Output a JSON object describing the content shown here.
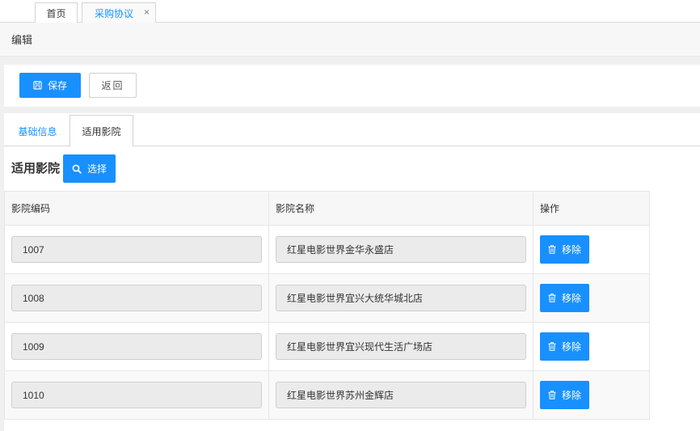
{
  "top_tabs": {
    "home": "首页",
    "active": "采购协议",
    "close": "×"
  },
  "title": "编辑",
  "toolbar": {
    "save_label": "保存",
    "back_label": "返回"
  },
  "content_tabs": {
    "basic": "基础信息",
    "cinemas": "适用影院"
  },
  "section": {
    "title": "适用影院",
    "select_label": "选择"
  },
  "table": {
    "headers": [
      "影院编码",
      "影院名称",
      "操作"
    ],
    "remove_label": "移除",
    "rows": [
      {
        "code": "1007",
        "name": "红星电影世界金华永盛店"
      },
      {
        "code": "1008",
        "name": "红星电影世界宜兴大统华城北店"
      },
      {
        "code": "1009",
        "name": "红星电影世界宜兴现代生活广场店"
      },
      {
        "code": "1010",
        "name": "红星电影世界苏州金辉店"
      }
    ]
  },
  "colors": {
    "primary": "#1890ff",
    "field_bg": "#ebebeb",
    "header_bg": "#f7f7f7"
  },
  "icons": {
    "save": "save-icon",
    "search": "search-icon",
    "remove": "trash-icon",
    "close": "close-icon"
  }
}
